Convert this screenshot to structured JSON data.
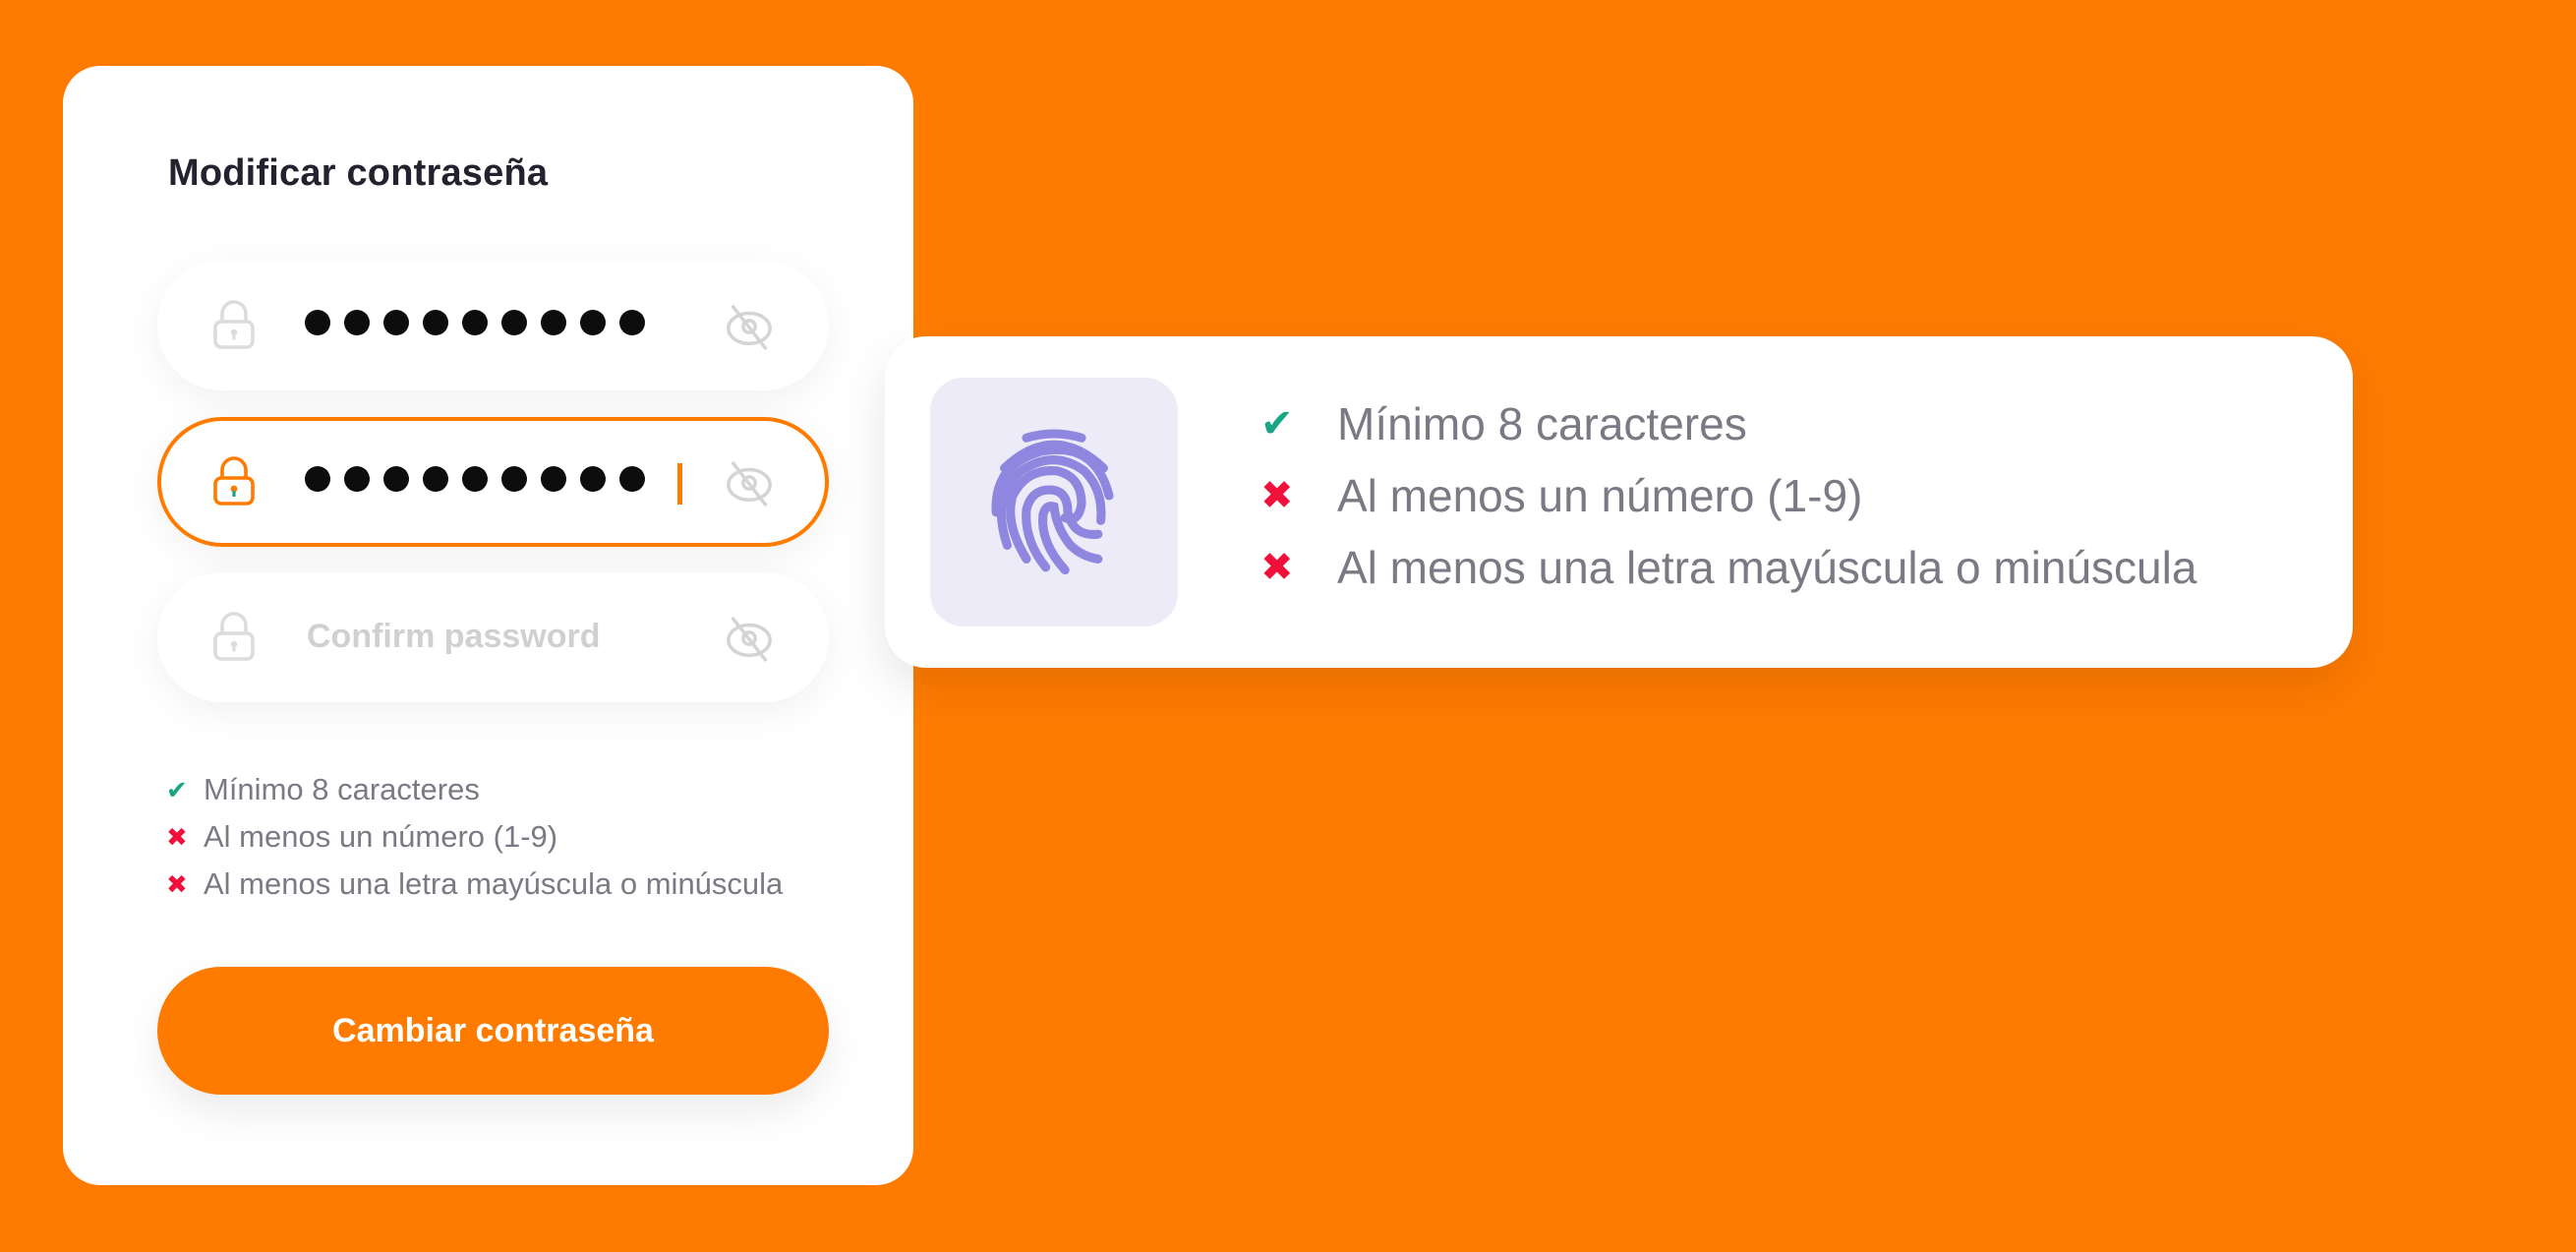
{
  "colors": {
    "background": "#FF7B00",
    "accent": "#FF7B00",
    "success": "#17a584",
    "error": "#F0113A",
    "fingerprint": "#8F86E0",
    "fingerprint_tile": "#EEEBF8"
  },
  "form": {
    "title": "Modificar contraseña",
    "fields": [
      {
        "name": "current-password",
        "value_masked_length": 9,
        "state": "filled",
        "placeholder": ""
      },
      {
        "name": "new-password",
        "value_masked_length": 9,
        "state": "focused",
        "placeholder": ""
      },
      {
        "name": "confirm-password",
        "value_masked_length": 0,
        "state": "empty",
        "placeholder": "Confirm password"
      }
    ],
    "requirements": [
      {
        "icon": "check-icon",
        "glyph": "✔",
        "status": "met",
        "label": "Mínimo 8 caracteres"
      },
      {
        "icon": "x-icon",
        "glyph": "✖",
        "status": "unmet",
        "label": "Al menos un número (1-9)"
      },
      {
        "icon": "x-icon",
        "glyph": "✖",
        "status": "unmet",
        "label": "Al menos una letra mayúscula o minúscula"
      }
    ],
    "submit_label": "Cambiar contraseña"
  },
  "callout": {
    "icon": "fingerprint-icon",
    "requirements": [
      {
        "icon": "check-icon",
        "glyph": "✔",
        "status": "met",
        "label": "Mínimo 8 caracteres"
      },
      {
        "icon": "x-icon",
        "glyph": "✖",
        "status": "unmet",
        "label": "Al menos un número (1-9)"
      },
      {
        "icon": "x-icon",
        "glyph": "✖",
        "status": "unmet",
        "label": "Al menos una letra mayúscula o minúscula"
      }
    ]
  }
}
